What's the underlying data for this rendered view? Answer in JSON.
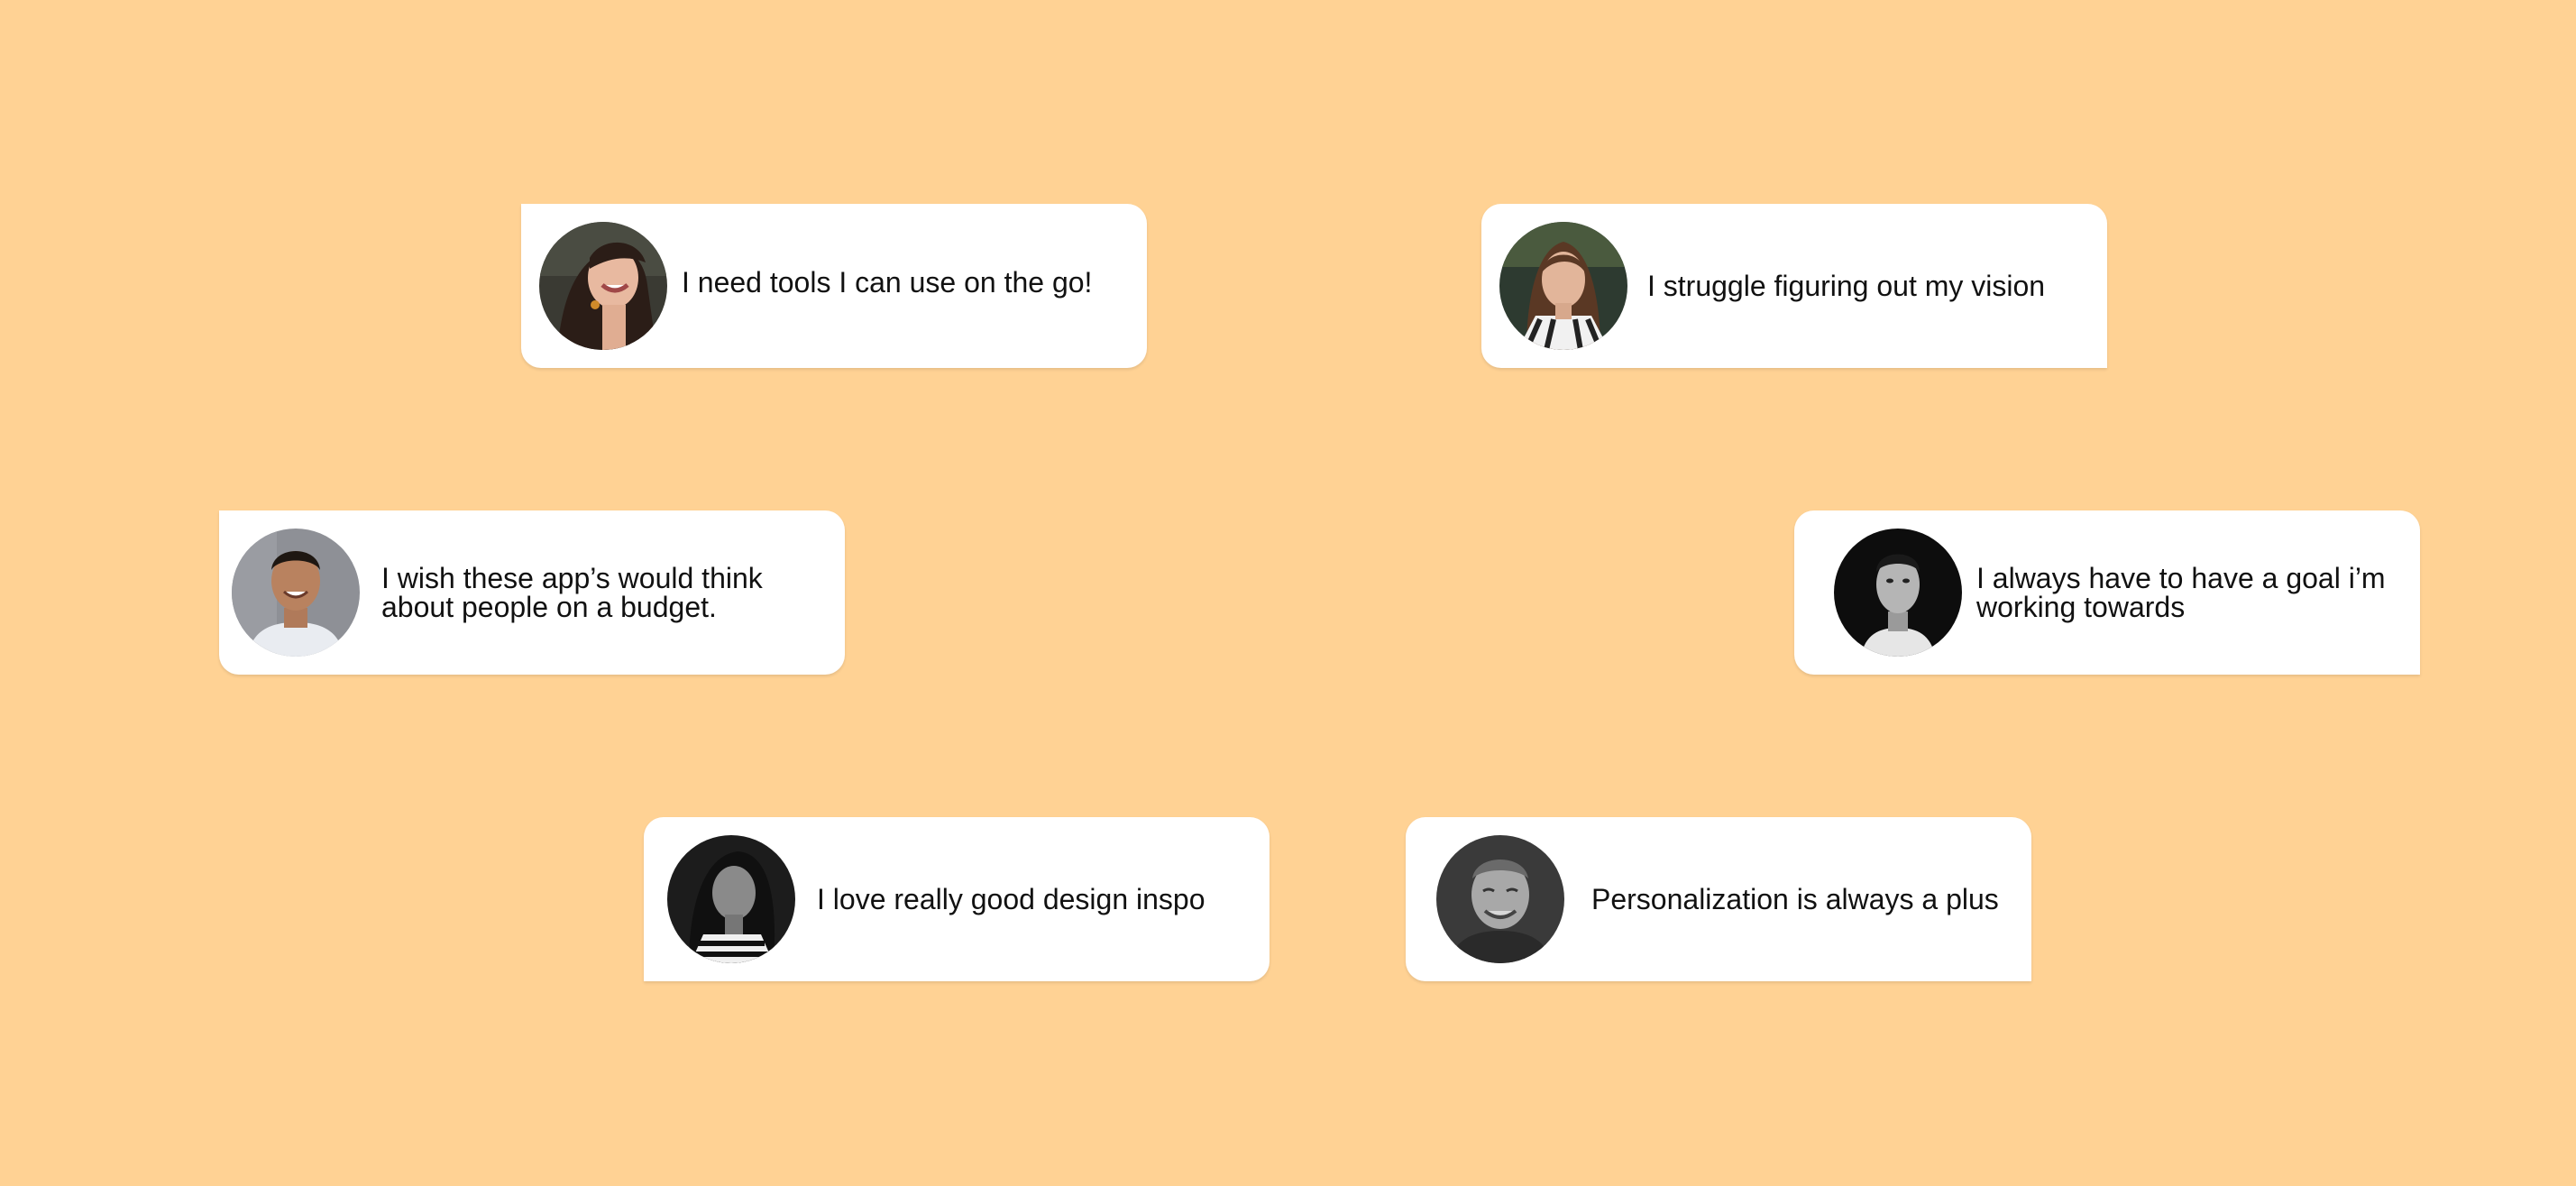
{
  "background_color": "#FFD294",
  "cards": [
    {
      "quote": "I need tools I can use on the go!",
      "avatar": "smiling-woman-photo"
    },
    {
      "quote": "I struggle figuring out my vision",
      "avatar": "woman-portrait-photo"
    },
    {
      "quote": "I wish these app’s would think about people on a budget.",
      "avatar": "smiling-man-photo"
    },
    {
      "quote": "I always have to have a goal i’m working towards",
      "avatar": "man-bw-portrait-photo"
    },
    {
      "quote": "I love really good design inspo",
      "avatar": "woman-bw-portrait-photo"
    },
    {
      "quote": "Personalization is always a plus",
      "avatar": "smiling-man-bw-photo"
    }
  ]
}
